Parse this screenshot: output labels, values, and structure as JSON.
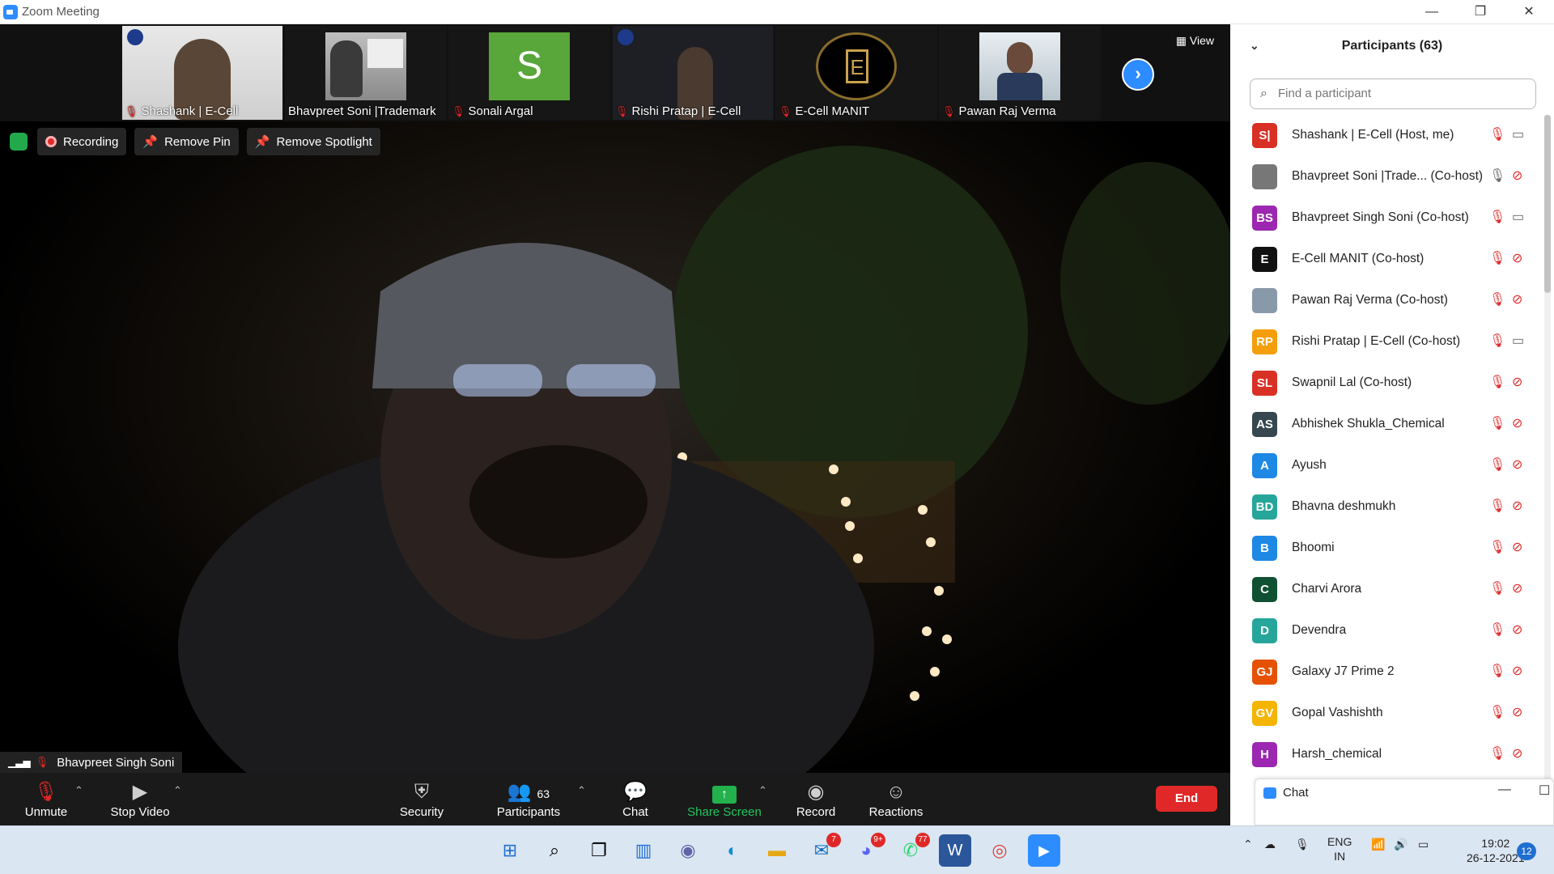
{
  "window": {
    "title": "Zoom Meeting",
    "minimize": "—",
    "restore": "❐",
    "close": "✕"
  },
  "strip": {
    "view_label": "View",
    "tiles": [
      {
        "name": "Shashank | E-Cell",
        "muted": true
      },
      {
        "name": "Bhavpreet Soni |Trademark",
        "muted": false
      },
      {
        "name": "Sonali Argal",
        "muted": true,
        "initial": "S"
      },
      {
        "name": "Rishi Pratap | E-Cell",
        "muted": true
      },
      {
        "name": "E-Cell MANIT",
        "muted": true
      },
      {
        "name": "Pawan Raj Verma",
        "muted": true
      }
    ]
  },
  "status": {
    "recording": "Recording",
    "remove_pin": "Remove Pin",
    "remove_spotlight": "Remove Spotlight"
  },
  "speaker": {
    "name": "Bhavpreet Singh Soni"
  },
  "toolbar": {
    "unmute": "Unmute",
    "stop_video": "Stop Video",
    "security": "Security",
    "participants": "Participants",
    "participants_count": "63",
    "chat": "Chat",
    "share_screen": "Share Screen",
    "record": "Record",
    "reactions": "Reactions",
    "end": "End"
  },
  "panel": {
    "title": "Participants (63)",
    "search_placeholder": "Find a participant",
    "participants": [
      {
        "initials": "S|",
        "name": "Shashank | E-Cell (Host, me)",
        "color": "#d93025",
        "mic": "muted",
        "cam": "on"
      },
      {
        "initials": "",
        "name": "Bhavpreet Soni |Trade...   (Co-host)",
        "color": "#777777",
        "mic": "on",
        "cam": "off"
      },
      {
        "initials": "BS",
        "name": "Bhavpreet Singh Soni (Co-host)",
        "color": "#9c27b0",
        "mic": "muted",
        "cam": "on"
      },
      {
        "initials": "E",
        "name": "E-Cell MANIT (Co-host)",
        "color": "#111111",
        "mic": "muted",
        "cam": "off"
      },
      {
        "initials": "",
        "name": "Pawan Raj Verma (Co-host)",
        "color": "#8899aa",
        "mic": "muted",
        "cam": "off"
      },
      {
        "initials": "RP",
        "name": "Rishi Pratap | E-Cell (Co-host)",
        "color": "#f59e0b",
        "mic": "muted",
        "cam": "on"
      },
      {
        "initials": "SL",
        "name": "Swapnil Lal (Co-host)",
        "color": "#d93025",
        "mic": "muted",
        "cam": "off"
      },
      {
        "initials": "AS",
        "name": "Abhishek Shukla_Chemical",
        "color": "#37474f",
        "mic": "muted",
        "cam": "off"
      },
      {
        "initials": "A",
        "name": "Ayush",
        "color": "#1e88e5",
        "mic": "muted",
        "cam": "off"
      },
      {
        "initials": "BD",
        "name": "Bhavna deshmukh",
        "color": "#26a69a",
        "mic": "muted",
        "cam": "off"
      },
      {
        "initials": "B",
        "name": "Bhoomi",
        "color": "#1e88e5",
        "mic": "muted",
        "cam": "off"
      },
      {
        "initials": "C",
        "name": "Charvi Arora",
        "color": "#0f5132",
        "mic": "muted",
        "cam": "off"
      },
      {
        "initials": "D",
        "name": "Devendra",
        "color": "#26a69a",
        "mic": "muted",
        "cam": "off"
      },
      {
        "initials": "GJ",
        "name": "Galaxy J7 Prime 2",
        "color": "#e65100",
        "mic": "muted",
        "cam": "off"
      },
      {
        "initials": "GV",
        "name": "Gopal Vashishth",
        "color": "#f5b400",
        "mic": "muted",
        "cam": "off"
      },
      {
        "initials": "H",
        "name": "Harsh_chemical",
        "color": "#9c27b0",
        "mic": "muted",
        "cam": "off"
      }
    ],
    "chat_label": "Chat"
  },
  "taskbar": {
    "lang": "ENG",
    "region": "IN",
    "time": "19:02",
    "date": "26-12-2021",
    "notifications": "12",
    "badges": {
      "mail": "7",
      "discord": "9+",
      "whatsapp": "77"
    }
  }
}
